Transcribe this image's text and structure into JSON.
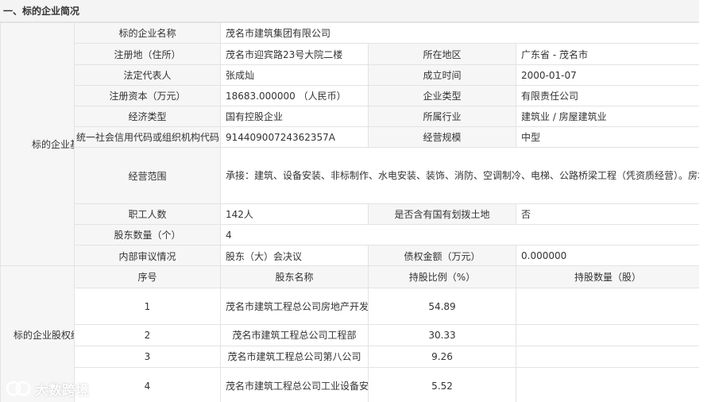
{
  "section_title": "一、标的企业简况",
  "basic": {
    "side_label": "标的企业基本情况",
    "company_name_label": "标的企业名称",
    "company_name": "茂名市建筑集团有限公司",
    "reg_address_label": "注册地（住所）",
    "reg_address": "茂名市迎宾路23号大院二楼",
    "region_label": "所在地区",
    "region": "广东省 - 茂名市",
    "legal_rep_label": "法定代表人",
    "legal_rep": "张成灿",
    "founded_label": "成立时间",
    "founded": "2000-01-07",
    "capital_label": "注册资本（万元）",
    "capital": "18683.000000 （人民币）",
    "company_type_label": "企业类型",
    "company_type": "有限责任公司",
    "econ_type_label": "经济类型",
    "econ_type": "国有控股企业",
    "industry_label": "所属行业",
    "industry": "建筑业 / 房屋建筑业",
    "credit_code_label": "统一社会信用代码或组织机构代码",
    "credit_code": "91440900724362357A",
    "scale_label": "经营规模",
    "scale": "中型",
    "scope_label": "经营范围",
    "scope": "承接：建筑、设备安装、非标制作、水电安装、装饰、消防、空调制冷、电梯、公路桥梁工程（凭资质经营）。房地产开动服务、技术咨询、工程设计、工程监理、建筑材料及建筑机械购销(依法须经批准的项目，经相关部门批准后方可开展经动)",
    "staff_label": "职工人数",
    "staff": "142人",
    "state_land_label": "是否含有国有划拨土地",
    "state_land": "否",
    "shareholder_count_label": "股东数量（个）",
    "shareholder_count": "4",
    "review_label": "内部审议情况",
    "review": "股东（大）会决议",
    "debt_label": "债权金额（万元）",
    "debt": "0.000000"
  },
  "equity": {
    "side_label": "标的企业股权结构",
    "headers": [
      "序号",
      "股东名称",
      "持股比例（%）",
      "持股数量（股）"
    ],
    "rows": [
      {
        "no": "1",
        "name": "茂名市建筑工程总公司房地产开发公司",
        "ratio": "54.89",
        "shares": ""
      },
      {
        "no": "2",
        "name": "茂名市建筑工程总公司工程部",
        "ratio": "30.33",
        "shares": ""
      },
      {
        "no": "3",
        "name": "茂名市建筑工程总公司第八公司",
        "ratio": "9.26",
        "shares": ""
      },
      {
        "no": "4",
        "name": "茂名市建筑工程总公司工业设备安装公司",
        "ratio": "5.52",
        "shares": ""
      }
    ]
  },
  "watermark": {
    "text": "大数跨境",
    "logo_icon": "double-loop-logo-icon"
  }
}
